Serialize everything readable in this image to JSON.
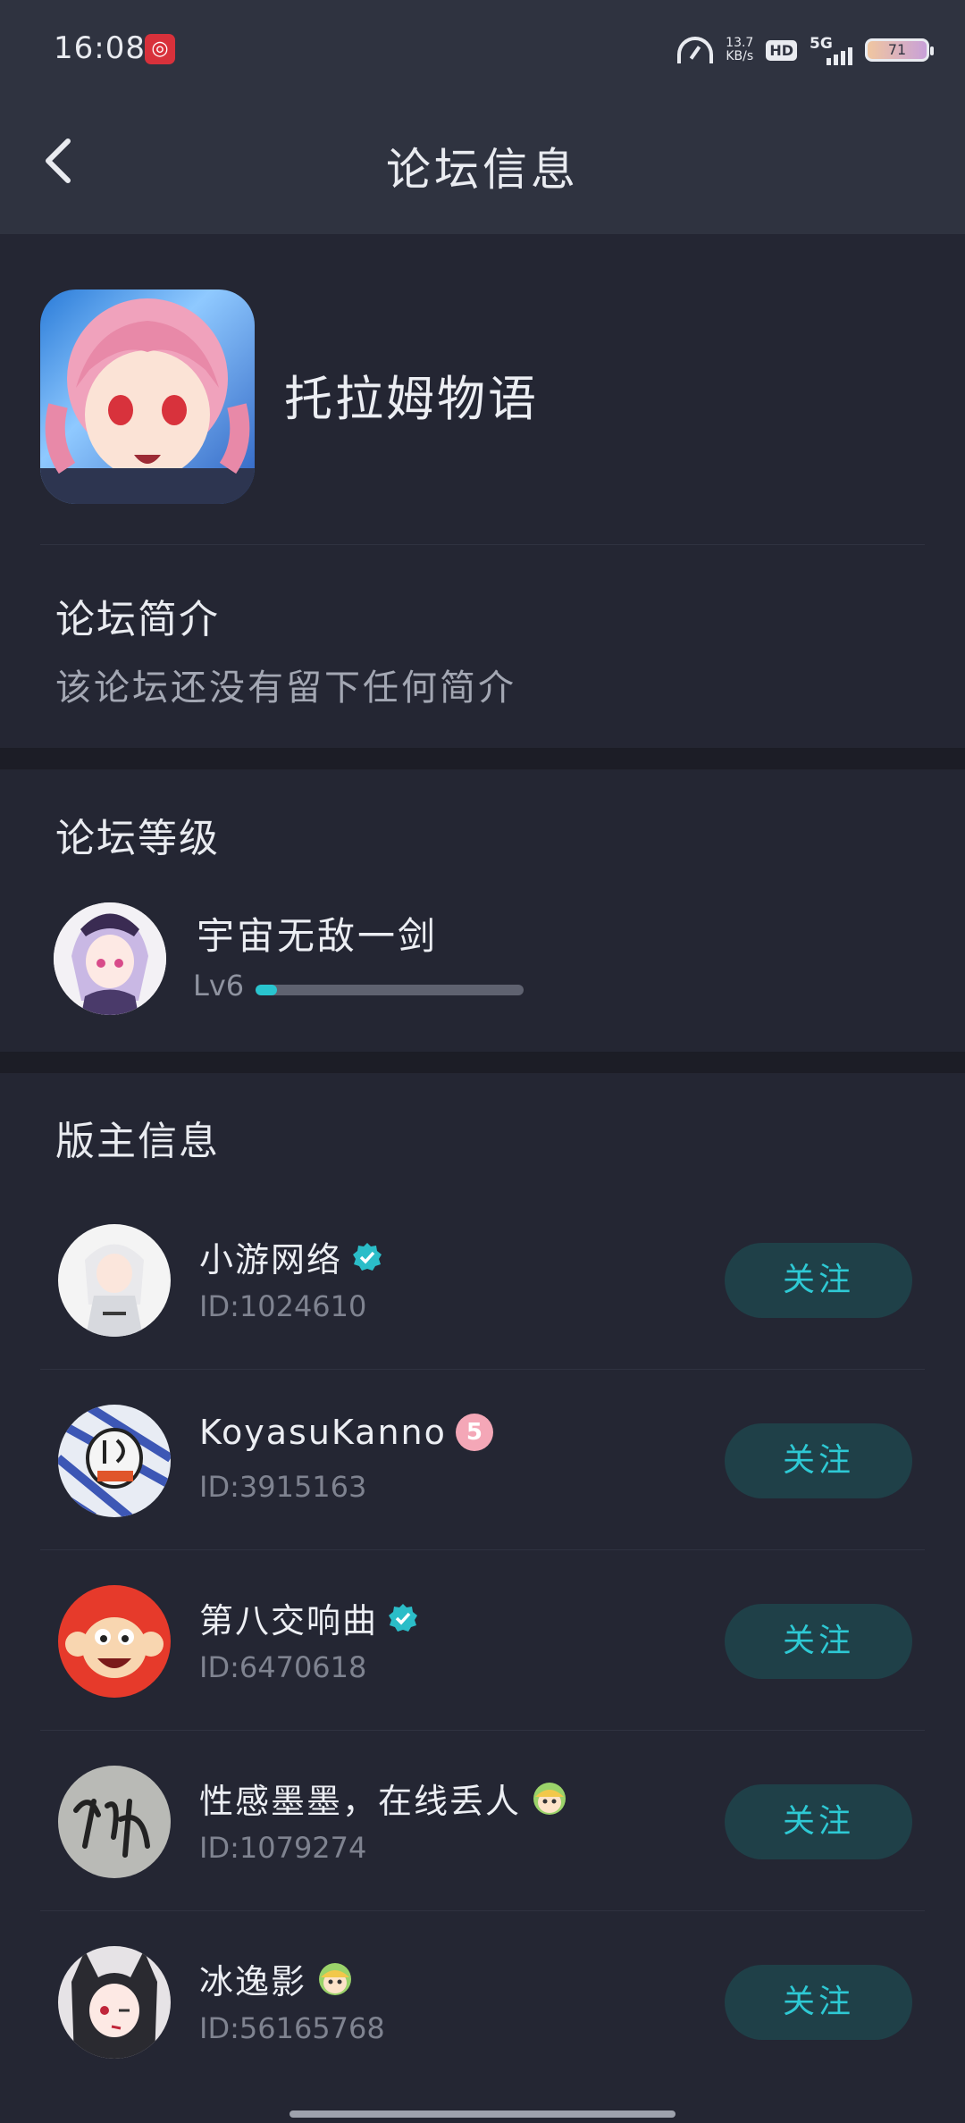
{
  "status_bar": {
    "time": "16:08",
    "speed_value": "13.7",
    "speed_unit": "KB/s",
    "hd": "HD",
    "network": "5G",
    "battery": "71"
  },
  "header": {
    "title": "论坛信息"
  },
  "forum": {
    "name": "托拉姆物语",
    "intro_title": "论坛简介",
    "intro_text": "该论坛还没有留下任何简介"
  },
  "level": {
    "section_title": "论坛等级",
    "user_name": "宇宙无敌一剑",
    "level_label": "Lv6",
    "progress_fraction": 0.08
  },
  "moderators": {
    "section_title": "版主信息",
    "follow_label": "关注",
    "items": [
      {
        "name": "小游网络",
        "id": "ID:1024610",
        "badge": "verified-icon"
      },
      {
        "name": "KoyasuKanno",
        "id": "ID:3915163",
        "badge": "level-5-badge"
      },
      {
        "name": "第八交响曲",
        "id": "ID:6470618",
        "badge": "verified-icon"
      },
      {
        "name": "性感墨墨，在线丢人",
        "id": "ID:1079274",
        "badge": "character-emoji-icon"
      },
      {
        "name": "冰逸影",
        "id": "ID:56165768",
        "badge": "character-emoji-icon"
      }
    ]
  },
  "colors": {
    "background": "#232530",
    "header": "#2f3340",
    "accent": "#29c5cf",
    "follow_bg": "#1f4048"
  }
}
